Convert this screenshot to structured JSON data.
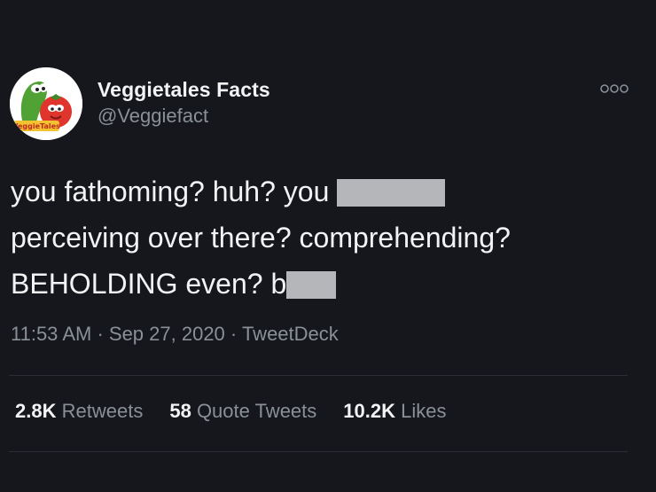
{
  "tweet": {
    "author": {
      "display_name": "Veggietales Facts",
      "handle": "@Veggiefact",
      "avatar_label": "VeggieTales"
    },
    "more_icon": "more-options-icon",
    "text": {
      "line1_before": "you fathoming? huh? you",
      "line2": "perceiving over there? comprehending?",
      "line3_before": "BEHOLDING even? b"
    },
    "meta": {
      "time": "11:53 AM",
      "date": "Sep 27, 2020",
      "source": "TweetDeck",
      "separator": " · "
    },
    "stats": {
      "retweets_count": "2.8K",
      "retweets_label": "Retweets",
      "quotes_count": "58",
      "quotes_label": "Quote Tweets",
      "likes_count": "10.2K",
      "likes_label": "Likes"
    }
  },
  "colors": {
    "background": "#15171c",
    "text_primary": "#f1f3f5",
    "text_secondary": "#8a9097",
    "divider": "#2b2f35",
    "censor_bar": "#b4b6b9"
  }
}
